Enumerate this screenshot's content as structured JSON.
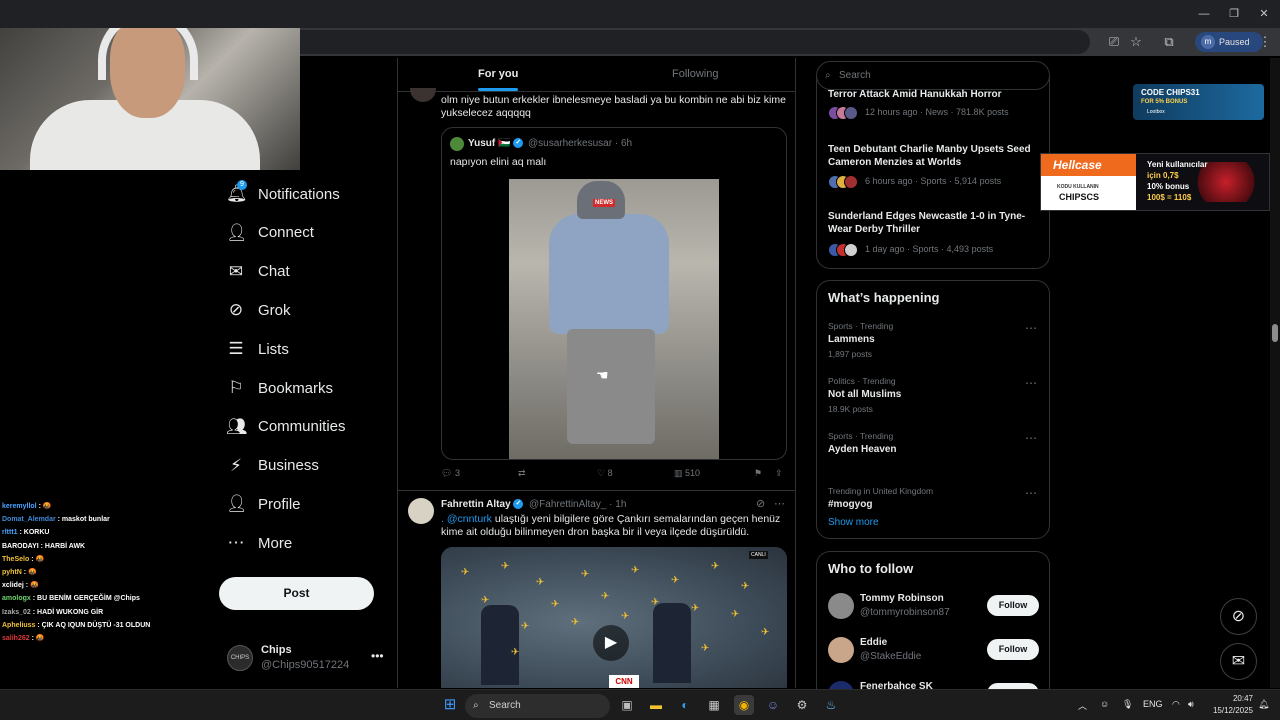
{
  "browser": {
    "profile_initial": "m",
    "profile_status": "Paused"
  },
  "chat_overlay": {
    "messages": [
      {
        "user": "keremyllol",
        "text": ": 🤬",
        "color": "#4aa3ff"
      },
      {
        "user": "Domat_Alemdar",
        "text": ": maskot bunlar",
        "color": "#3f8bd8"
      },
      {
        "user": "rlttt1",
        "text": ": KORKU",
        "color": "#4aa3ff"
      },
      {
        "user": "BARODAYI",
        "text": ": HARBİ AWK",
        "color": "#ffffff"
      },
      {
        "user": "TheSelo",
        "text": ": 🤬",
        "color": "#f0c23a"
      },
      {
        "user": "pyhtN",
        "text": ": 🤬",
        "color": "#f0c23a"
      },
      {
        "user": "xclidej",
        "text": ": 🤬",
        "color": "#ffffff"
      },
      {
        "user": "amologx",
        "text": ": BU BENİM GERÇEĞİM @Chips",
        "color": "#6fd36f"
      },
      {
        "user": "Izaks_02",
        "text": ": HADİ WUKONG GİR",
        "color": "#aaaaaa"
      },
      {
        "user": "Apheliuss",
        "text": ": ÇIK AQ IQUN DÜŞTÜ -31 OLDUN",
        "color": "#f0c23a"
      },
      {
        "user": "salih262",
        "text": ": 🤬",
        "color": "#d93a3a"
      }
    ]
  },
  "nav": {
    "items": [
      {
        "label": "Notifications",
        "icon": "bell-icon"
      },
      {
        "label": "Connect",
        "icon": "person-plus-icon"
      },
      {
        "label": "Chat",
        "icon": "mail-icon"
      },
      {
        "label": "Grok",
        "icon": "grok-icon"
      },
      {
        "label": "Lists",
        "icon": "list-icon"
      },
      {
        "label": "Bookmarks",
        "icon": "bookmark-icon"
      },
      {
        "label": "Communities",
        "icon": "people-icon"
      },
      {
        "label": "Business",
        "icon": "lightning-icon"
      },
      {
        "label": "Profile",
        "icon": "person-icon"
      },
      {
        "label": "More",
        "icon": "more-circle-icon"
      }
    ],
    "notifications_badge": "9",
    "post_label": "Post",
    "account_name": "Chips",
    "account_handle": "@Chips90517224",
    "account_avatar_text": "CHIPS"
  },
  "feed": {
    "tab_for_you": "For you",
    "tab_following": "Following",
    "tweet1": {
      "text": "olm niye butun erkekler ibnelesmeye basladi ya bu kombin ne abi biz kime yukselecez aqqqqq",
      "quote_name": "Yusuf 🇵🇸",
      "quote_handle": "@susarherkesusar · 6h",
      "quote_text": "napıyon elini aq malı",
      "badge": "NEWS",
      "replies": "3",
      "likes": "8",
      "views": "510"
    },
    "tweet2": {
      "name": "Fahrettin Altay",
      "handle": "@FahrettinAltay_ · 1h",
      "mention": ". @cnnturk",
      "text": " ulaştığı yeni bilgilere göre Çankırı semalarından geçen henüz kime ait olduğu bilinmeyen dron başka bir il veya ilçede düşürüldü.",
      "video_logo": "CNN",
      "video_corner": "CANLI"
    }
  },
  "search": {
    "placeholder": "Search"
  },
  "news": [
    {
      "title": "Terror Attack Amid Hanukkah Horror",
      "meta": "12 hours ago · News · 781.8K posts"
    },
    {
      "title": "Teen Debutant Charlie Manby Upsets Seed Cameron Menzies at Worlds",
      "meta": "6 hours ago · Sports · 5,914 posts"
    },
    {
      "title": "Sunderland Edges Newcastle 1-0 in Tyne-Wear Derby Thriller",
      "meta": "1 day ago · Sports · 4,493 posts"
    }
  ],
  "happening": {
    "title": "What’s happening",
    "trends": [
      {
        "meta": "Sports · Trending",
        "name": "Lammens",
        "count": "1,897 posts"
      },
      {
        "meta": "Politics · Trending",
        "name": "Not all Muslims",
        "count": "18.9K posts"
      },
      {
        "meta": "Sports · Trending",
        "name": "Ayden Heaven",
        "count": ""
      },
      {
        "meta": "Trending in United Kingdom",
        "name": "#mogyog",
        "count": ""
      }
    ],
    "show_more": "Show more"
  },
  "who_to_follow": {
    "title": "Who to follow",
    "follow_label": "Follow",
    "accounts": [
      {
        "name": "Tommy Robinson",
        "handle": "@tommyrobinson87"
      },
      {
        "name": "Eddie",
        "handle": "@StakeEddie"
      },
      {
        "name": "Fenerbahce SK",
        "handle": ""
      }
    ]
  },
  "ads": {
    "ad1_line1": "CODE CHIPS31",
    "ad1_line2": "FOR 5% BONUS",
    "ad1_line3": "Lootbox",
    "ad2_brand": "Hellcase",
    "ad2_kod": "KODU KULLANIN",
    "ad2_code": "CHIPSCS",
    "ad2_line1": "Yeni kullanıcılar",
    "ad2_line2": "için 0,7$",
    "ad2_line3": "10% bonus",
    "ad2_line4": "100$ = 110$"
  },
  "taskbar": {
    "search_label": "Search",
    "lang": "ENG",
    "time": "20:47",
    "date": "15/12/2025"
  }
}
